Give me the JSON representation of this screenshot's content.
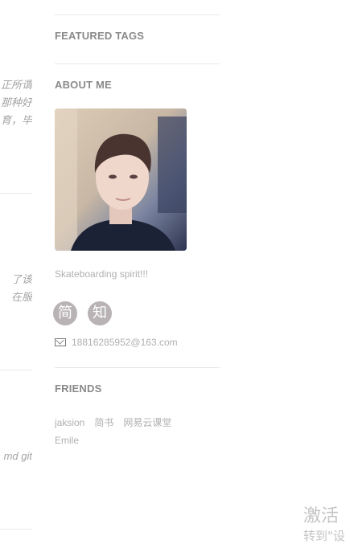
{
  "left_fragments": [
    {
      "lines": [
        "正所谓",
        "那种好",
        "育，毕"
      ]
    },
    {
      "lines": [
        "了该",
        "在服"
      ]
    },
    {
      "lines": [
        "md git"
      ]
    }
  ],
  "sidebar": {
    "featured_tags_heading": "FEATURED TAGS",
    "about_heading": "ABOUT ME",
    "bio": "Skateboarding spirit!!!",
    "social": [
      "简",
      "知"
    ],
    "email": "18816285952@163.com",
    "friends_heading": "FRIENDS",
    "friends": [
      "jaksion",
      "简书",
      "网易云课堂",
      "Emile"
    ]
  },
  "watermark": {
    "line1": "激活",
    "line2": "转到\"设"
  }
}
